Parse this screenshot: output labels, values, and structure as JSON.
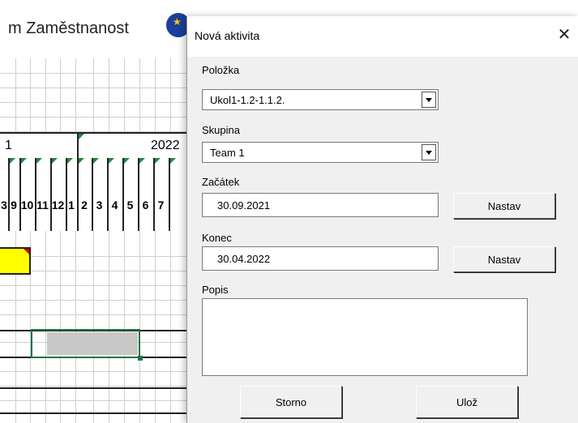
{
  "background": {
    "banner_text": "m Zaměstnanost",
    "year_left": "1",
    "year_right": "2022",
    "months": [
      "3",
      "9",
      "10",
      "11",
      "12",
      "1",
      "2",
      "3",
      "4",
      "5",
      "6",
      "7"
    ]
  },
  "dialog": {
    "title": "Nová aktivita",
    "close_symbol": "✕",
    "polozka": {
      "label": "Položka",
      "value": "Ukol1-1.2-1.1.2."
    },
    "skupina": {
      "label": "Skupina",
      "value": "Team 1"
    },
    "zacatek": {
      "label": "Začátek",
      "value": "30.09.2021",
      "button": "Nastav"
    },
    "konec": {
      "label": "Konec",
      "value": "30.04.2022",
      "button": "Nastav"
    },
    "popis": {
      "label": "Popis",
      "value": ""
    },
    "storno_label": "Storno",
    "uloz_label": "Ulož"
  },
  "colors": {
    "selection": "#217346",
    "highlight_cell": "#ffff00",
    "eu_blue": "#1b3f9a"
  }
}
